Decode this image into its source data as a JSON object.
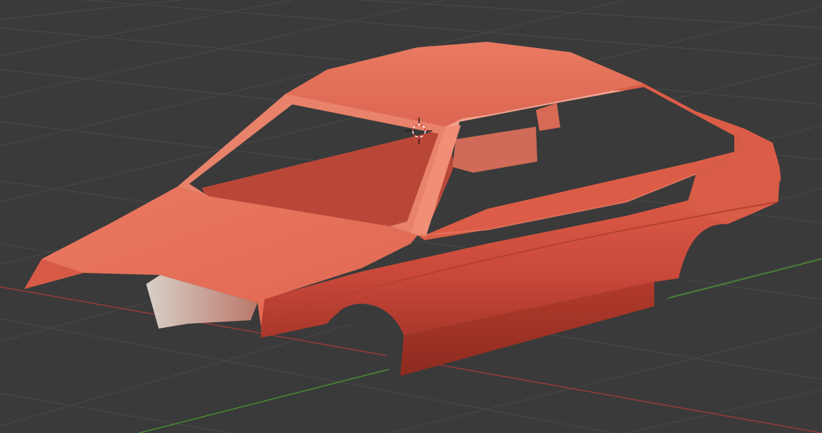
{
  "viewport": {
    "background": "#3a3a3a",
    "grid_color": "#4a4a4a",
    "x_axis_color": "#9b3a3a",
    "y_axis_color": "#4a8f2e"
  },
  "model": {
    "body_color": "#e0654f",
    "shade_color": "#c84b3a",
    "dark_color": "#9e3324",
    "highlight_color": "#f4a08c"
  },
  "cursor": {
    "icon": "3d-cursor-icon",
    "ring_color": "#ffffff",
    "alt_color": "#d04040"
  }
}
